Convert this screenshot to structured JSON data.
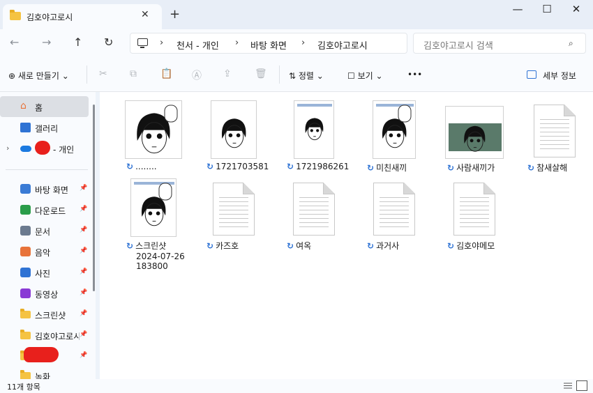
{
  "tab": {
    "title": "김호야고로시",
    "close": "✕",
    "new_tab": "+"
  },
  "window": {
    "minimize": "—",
    "maximize": "☐",
    "close": "✕"
  },
  "nav_buttons": {
    "back": "←",
    "forward": "→",
    "up": "↑",
    "refresh": "↻"
  },
  "breadcrumb": [
    "천서 - 개인",
    "바탕 화면",
    "김호야고로시"
  ],
  "breadcrumb_sep": "›",
  "search": {
    "placeholder": "김호야고로시 검색",
    "icon": "⌕"
  },
  "toolbar": {
    "new": "⊕ 새로 만들기 ⌄",
    "cut": "✂",
    "copy": "⧉",
    "paste": "📋",
    "rename": "Ⓐ",
    "share": "⇪",
    "delete": "🗑",
    "sort": "⇅ 정렬 ⌄",
    "view": "☐ 보기 ⌄",
    "more": "•••",
    "details": "세부 정보"
  },
  "sidebar": {
    "home": "홈",
    "gallery": "갤러리",
    "onedrive": "- 개인",
    "items": [
      {
        "label": "바탕 화면",
        "icon": "desktop-icon",
        "color": "#3a7bd5"
      },
      {
        "label": "다운로드",
        "icon": "download-icon",
        "color": "#2a9d4a"
      },
      {
        "label": "문서",
        "icon": "document-icon",
        "color": "#6b7a8f"
      },
      {
        "label": "음악",
        "icon": "music-icon",
        "color": "#e8733a"
      },
      {
        "label": "사진",
        "icon": "pictures-icon",
        "color": "#2f73d4"
      },
      {
        "label": "동영상",
        "icon": "video-icon",
        "color": "#8a3ad5"
      },
      {
        "label": "스크린샷",
        "icon": "folder-icon",
        "color": "#f5c342"
      },
      {
        "label": "김호야고로시",
        "icon": "folder-icon",
        "color": "#f5c342"
      },
      {
        "label": "",
        "icon": "folder-icon",
        "color": "#f5c342"
      },
      {
        "label": "녹화",
        "icon": "folder-icon",
        "color": "#f5c342"
      }
    ],
    "pin": "📌"
  },
  "files": [
    {
      "name": "........",
      "kind": "image"
    },
    {
      "name": "1721703581",
      "kind": "image"
    },
    {
      "name": "1721986261",
      "kind": "image"
    },
    {
      "name": "미친새끼",
      "kind": "image"
    },
    {
      "name": "사람새끼가",
      "kind": "image"
    },
    {
      "name": "참새살해",
      "kind": "text"
    },
    {
      "name": "스크린샷",
      "name2": "2024-07-26",
      "name3": "183800",
      "kind": "image"
    },
    {
      "name": "카즈호",
      "kind": "text"
    },
    {
      "name": "여옥",
      "kind": "text"
    },
    {
      "name": "과거사",
      "kind": "text"
    },
    {
      "name": "김호야메모",
      "kind": "text"
    }
  ],
  "sync_glyph": "↻",
  "status": {
    "count": "11개 항목"
  },
  "colors": {
    "accent": "#2f73d4",
    "folder": "#f5c342",
    "redact": "#e8201c"
  }
}
